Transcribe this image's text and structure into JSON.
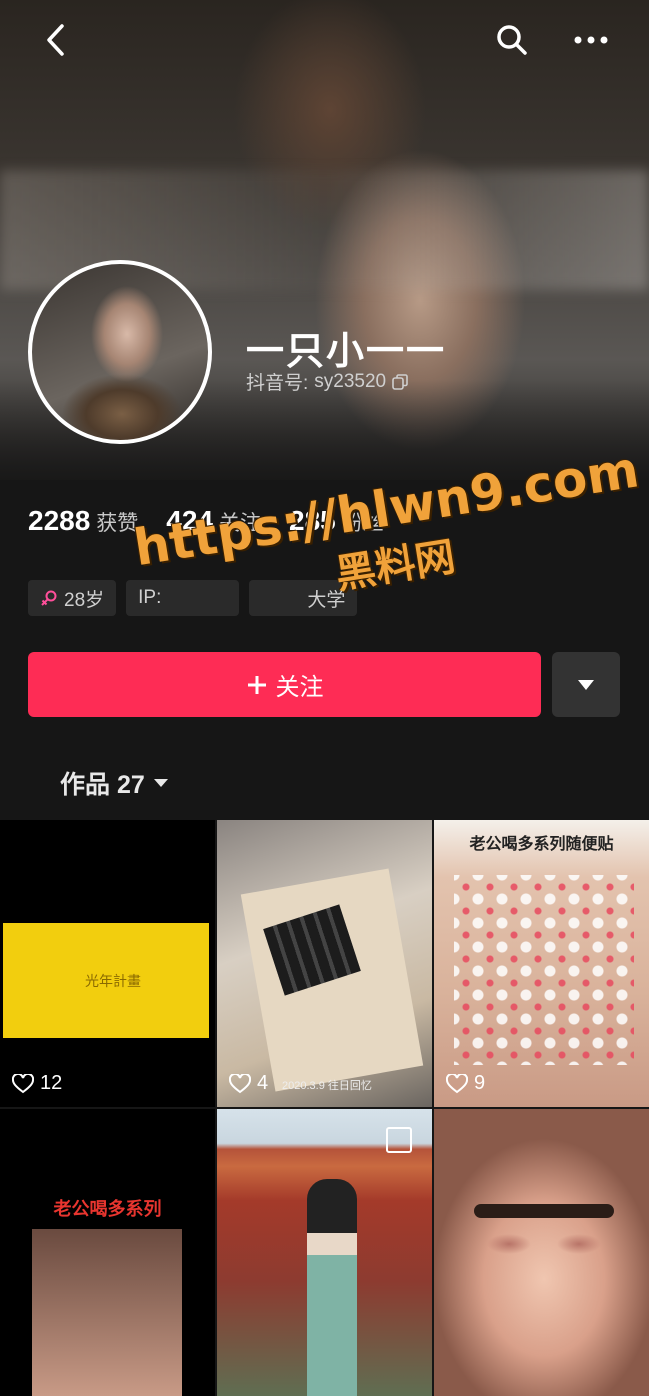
{
  "profile": {
    "nickname": "一只小一一",
    "douyin_id_label": "抖音号:",
    "douyin_id": "sy23520"
  },
  "stats": [
    {
      "num": "2288",
      "label": "获赞"
    },
    {
      "num": "424",
      "label": "关注"
    },
    {
      "num": "285",
      "label": "粉丝"
    }
  ],
  "tags": [
    {
      "icon": "female-icon",
      "text": "28岁"
    },
    {
      "text": "IP:"
    },
    {
      "text": "大学"
    }
  ],
  "actions": {
    "follow_label": "关注"
  },
  "tabs": {
    "works_label": "作品 27"
  },
  "watermark": {
    "url": "https://hlwn9.com",
    "text": "黑料网"
  },
  "videos": [
    {
      "likes": "12",
      "caption": "光年計畫"
    },
    {
      "likes": "4",
      "caption": "2020.3.9 往日回忆"
    },
    {
      "likes": "9",
      "caption": "老公喝多系列随便贴"
    },
    {
      "likes": "",
      "caption": "老公喝多系列"
    },
    {
      "likes": "",
      "caption": ""
    },
    {
      "likes": "",
      "caption": ""
    }
  ],
  "colors": {
    "accent": "#fe2c55",
    "watermark": "#f0a23a",
    "background": "#161616"
  }
}
